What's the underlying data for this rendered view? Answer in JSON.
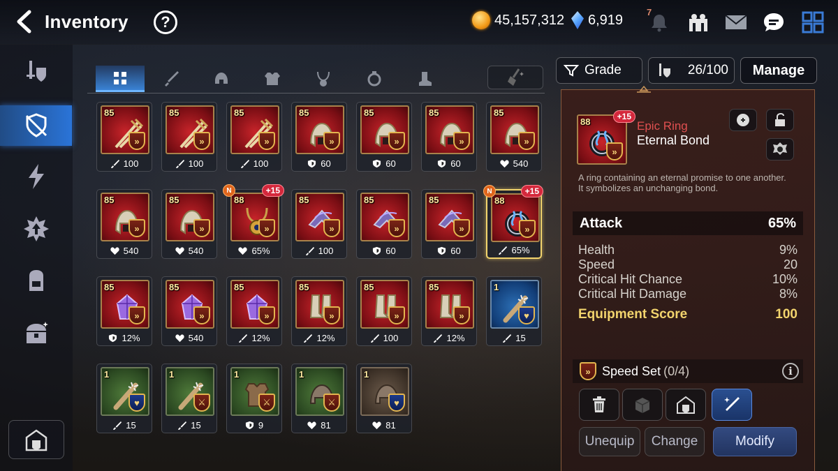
{
  "header": {
    "title": "Inventory",
    "help_label": "?",
    "gold": "45,157,312",
    "crystals": "6,919",
    "notification_count": "7"
  },
  "tabs": [
    {
      "name": "all"
    },
    {
      "name": "weapon"
    },
    {
      "name": "helmet"
    },
    {
      "name": "armor"
    },
    {
      "name": "necklace"
    },
    {
      "name": "ring"
    },
    {
      "name": "boots"
    }
  ],
  "toolbar": {
    "sort_label": "Grade",
    "capacity": "26/100",
    "manage_label": "Manage"
  },
  "items": [
    {
      "level": "85",
      "grade": "epic",
      "type": "weapon",
      "stat_icon": "attack",
      "stat": "100"
    },
    {
      "level": "85",
      "grade": "epic",
      "type": "weapon",
      "stat_icon": "attack",
      "stat": "100"
    },
    {
      "level": "85",
      "grade": "epic",
      "type": "weapon",
      "stat_icon": "attack",
      "stat": "100"
    },
    {
      "level": "85",
      "grade": "epic",
      "type": "helmet",
      "stat_icon": "defense",
      "stat": "60"
    },
    {
      "level": "85",
      "grade": "epic",
      "type": "helmet",
      "stat_icon": "defense",
      "stat": "60"
    },
    {
      "level": "85",
      "grade": "epic",
      "type": "helmet",
      "stat_icon": "defense",
      "stat": "60"
    },
    {
      "level": "85",
      "grade": "epic",
      "type": "helmet",
      "stat_icon": "health",
      "stat": "540"
    },
    {
      "level": "85",
      "grade": "epic",
      "type": "helmet",
      "stat_icon": "health",
      "stat": "540"
    },
    {
      "level": "85",
      "grade": "epic",
      "type": "helmet",
      "stat_icon": "health",
      "stat": "540"
    },
    {
      "level": "88",
      "grade": "epic",
      "type": "necklace",
      "stat_icon": "health",
      "stat": "65%",
      "enhance": "+15",
      "is_new": true,
      "new_label": "N"
    },
    {
      "level": "85",
      "grade": "epic",
      "type": "armor",
      "stat_icon": "attack",
      "stat": "100"
    },
    {
      "level": "85",
      "grade": "epic",
      "type": "armor",
      "stat_icon": "defense",
      "stat": "60"
    },
    {
      "level": "85",
      "grade": "epic",
      "type": "armor",
      "stat_icon": "defense",
      "stat": "60"
    },
    {
      "level": "88",
      "grade": "epic",
      "type": "ring",
      "stat_icon": "attack",
      "stat": "65%",
      "enhance": "+15",
      "is_new": true,
      "new_label": "N",
      "selected": true
    },
    {
      "level": "85",
      "grade": "epic",
      "type": "gem",
      "stat_icon": "defense",
      "stat": "12%"
    },
    {
      "level": "85",
      "grade": "epic",
      "type": "gem",
      "stat_icon": "health",
      "stat": "540"
    },
    {
      "level": "85",
      "grade": "epic",
      "type": "gem",
      "stat_icon": "attack",
      "stat": "12%"
    },
    {
      "level": "85",
      "grade": "epic",
      "type": "boots",
      "stat_icon": "attack",
      "stat": "12%"
    },
    {
      "level": "85",
      "grade": "epic",
      "type": "boots",
      "stat_icon": "attack",
      "stat": "100"
    },
    {
      "level": "85",
      "grade": "epic",
      "type": "boots",
      "stat_icon": "attack",
      "stat": "12%"
    },
    {
      "level": "1",
      "grade": "rare",
      "type": "club",
      "stat_icon": "attack",
      "stat": "15",
      "set": "heart"
    },
    {
      "level": "1",
      "grade": "normal",
      "type": "club",
      "stat_icon": "attack",
      "stat": "15",
      "set": "heart"
    },
    {
      "level": "1",
      "grade": "normal",
      "type": "club",
      "stat_icon": "attack",
      "stat": "15",
      "set": "sword"
    },
    {
      "level": "1",
      "grade": "normal",
      "type": "vest",
      "stat_icon": "defense",
      "stat": "9",
      "set": "sword"
    },
    {
      "level": "1",
      "grade": "normal",
      "type": "cap",
      "stat_icon": "health",
      "stat": "81",
      "set": "sword"
    },
    {
      "level": "1",
      "grade": "brown",
      "type": "cap",
      "stat_icon": "health",
      "stat": "81",
      "set": "heart"
    }
  ],
  "detail": {
    "level": "88",
    "enhance": "+15",
    "grade_label": "Epic Ring",
    "name": "Eternal Bond",
    "description_1": "A ring containing an eternal promise to one another.",
    "description_2": "It symbolizes an unchanging bond.",
    "main_stat": {
      "label": "Attack",
      "value": "65%"
    },
    "substats": [
      {
        "label": "Health",
        "value": "9%"
      },
      {
        "label": "Speed",
        "value": "20"
      },
      {
        "label": "Critical Hit Chance",
        "value": "10%"
      },
      {
        "label": "Critical Hit Damage",
        "value": "8%"
      }
    ],
    "score_label": "Equipment Score",
    "score_value": "100",
    "set_label": "Speed Set",
    "set_count": "(0/4)",
    "info_label": "i",
    "unequip_label": "Unequip",
    "change_label": "Change",
    "modify_label": "Modify"
  },
  "colors": {
    "accent_blue": "#2a74d8",
    "gold_text": "#f2d46d",
    "epic_red": "#e05050",
    "panel_bg": "#3a1e1a"
  }
}
